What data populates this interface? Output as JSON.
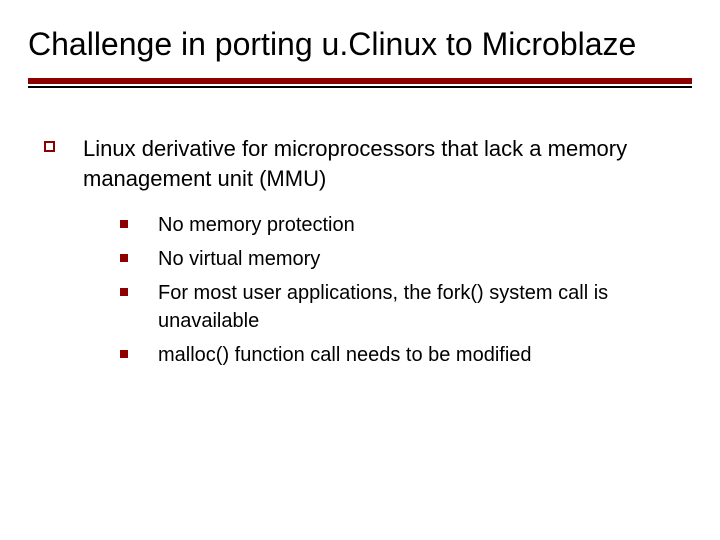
{
  "slide": {
    "title": "Challenge in porting u.Clinux to Microblaze",
    "main_point": "Linux derivative for microprocessors that lack a memory management unit (MMU)",
    "sub_points": [
      "No memory protection",
      "No virtual memory",
      "For most user applications, the fork() system call is unavailable",
      "malloc() function call needs to be modified"
    ]
  }
}
